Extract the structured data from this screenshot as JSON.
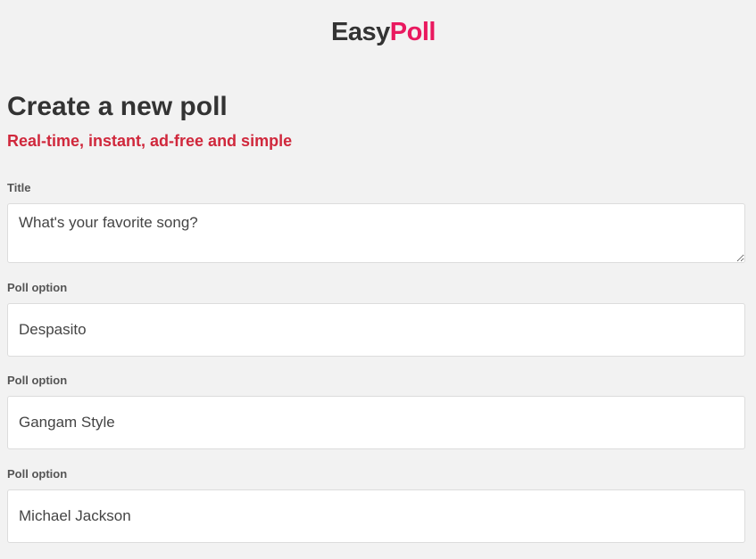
{
  "header": {
    "brand_part1": "Easy",
    "brand_part2": "Poll",
    "brand_colors": {
      "part1": "#333333",
      "part2": "#e9195f"
    }
  },
  "main": {
    "heading": "Create a new poll",
    "subheading": "Real-time, instant, ad-free and simple",
    "subheading_color": "#d0283c"
  },
  "form": {
    "title": {
      "label": "Title",
      "value": "What's your favorite song?"
    },
    "options": [
      {
        "label": "Poll option",
        "value": "Despasito"
      },
      {
        "label": "Poll option",
        "value": "Gangam Style"
      },
      {
        "label": "Poll option",
        "value": "Michael Jackson"
      }
    ]
  }
}
